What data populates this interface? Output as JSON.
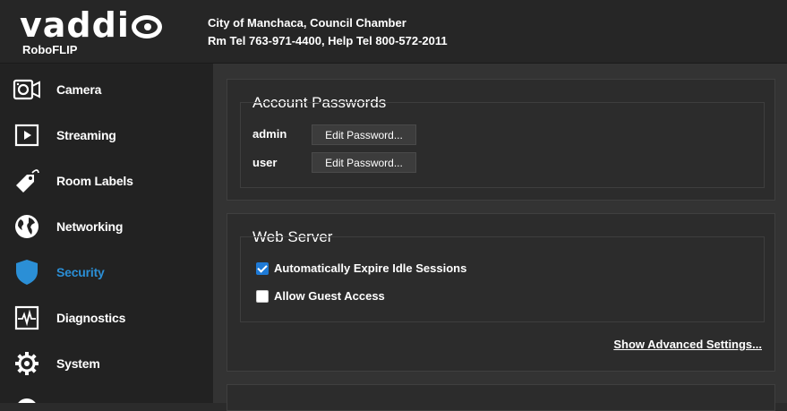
{
  "brand": {
    "logo_text": "vaddio",
    "product": "RoboFLIP"
  },
  "site": {
    "line1": "City of Manchaca, Council Chamber",
    "line2": "Rm Tel 763-971-4400, Help Tel 800-572-2011"
  },
  "sidebar": {
    "items": [
      {
        "label": "Camera",
        "icon": "camera-icon"
      },
      {
        "label": "Streaming",
        "icon": "play-icon"
      },
      {
        "label": "Room Labels",
        "icon": "tag-icon"
      },
      {
        "label": "Networking",
        "icon": "globe-icon"
      },
      {
        "label": "Security",
        "icon": "shield-icon",
        "active": true
      },
      {
        "label": "Diagnostics",
        "icon": "pulse-icon"
      },
      {
        "label": "System",
        "icon": "gear-icon"
      }
    ],
    "active_color": "#2b8fd6"
  },
  "account_passwords": {
    "title": "Account Passwords",
    "rows": [
      {
        "user": "admin",
        "button": "Edit Password..."
      },
      {
        "user": "user",
        "button": "Edit Password..."
      }
    ]
  },
  "web_server": {
    "title": "Web Server",
    "options": [
      {
        "label": "Automatically Expire Idle Sessions",
        "checked": true
      },
      {
        "label": "Allow Guest Access",
        "checked": false
      }
    ],
    "advanced_link": "Show Advanced Settings..."
  }
}
